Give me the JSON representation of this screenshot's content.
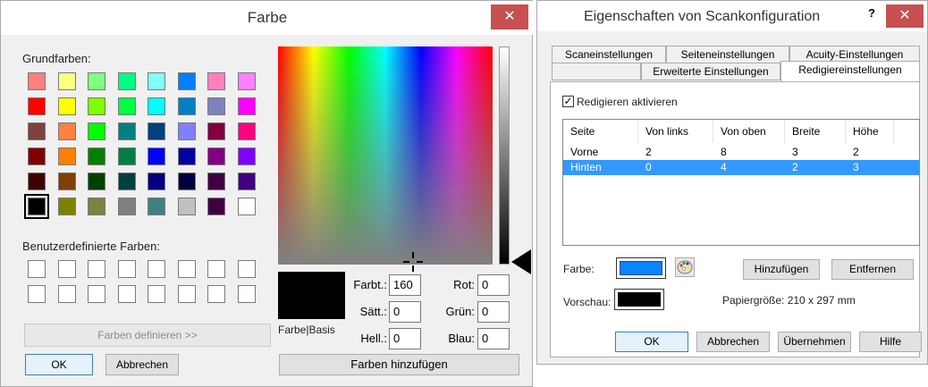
{
  "farbe": {
    "title": "Farbe",
    "close": "✕",
    "basic_label": "Grundfarben:",
    "basic_colors": [
      [
        "#ff8080",
        "#ffff80",
        "#80ff80",
        "#00ff80",
        "#80ffff",
        "#0080ff",
        "#ff80c0",
        "#ff80ff"
      ],
      [
        "#ff0000",
        "#ffff00",
        "#80ff00",
        "#00ff40",
        "#00ffff",
        "#0080c0",
        "#8080c0",
        "#ff00ff"
      ],
      [
        "#804040",
        "#ff8040",
        "#00ff00",
        "#008080",
        "#004080",
        "#8080ff",
        "#800040",
        "#ff0080"
      ],
      [
        "#800000",
        "#ff8000",
        "#008000",
        "#008040",
        "#0000ff",
        "#0000a0",
        "#800080",
        "#8000ff"
      ],
      [
        "#400000",
        "#804000",
        "#004000",
        "#004040",
        "#000080",
        "#000040",
        "#400040",
        "#400080"
      ],
      [
        "#000000",
        "#808000",
        "#808040",
        "#808080",
        "#408080",
        "#c0c0c0",
        "#400040",
        "#ffffff"
      ]
    ],
    "custom_label": "Benutzerdefinierte Farben:",
    "define_button": "Farben definieren >>",
    "ok": "OK",
    "cancel": "Abbrechen",
    "preview_label": "Farbe|Basis",
    "hue_label": "Farbt.:",
    "hue_value": "160",
    "sat_label": "Sätt.:",
    "sat_value": "0",
    "lum_label": "Hell.:",
    "lum_value": "0",
    "red_label": "Rot:",
    "red_value": "0",
    "green_label": "Grün:",
    "green_value": "0",
    "blue_label": "Blau:",
    "blue_value": "0",
    "add_button": "Farben hinzufügen",
    "selected_color": "#000000"
  },
  "scan": {
    "title": "Eigenschaften von Scankonfiguration",
    "help": "?",
    "close": "✕",
    "tabs_row1": [
      "Scaneinstellungen",
      "Seiteneinstellungen",
      "Acuity-Einstellungen"
    ],
    "tabs_row2": [
      "Erweiterte Einstellungen",
      "Redigiereinstellungen"
    ],
    "enable_label": "Redigieren aktivieren",
    "enable_checked": true,
    "columns": [
      "Seite",
      "Von links",
      "Von oben",
      "Breite",
      "Höhe"
    ],
    "rows": [
      [
        "Vorne",
        "2",
        "8",
        "3",
        "2"
      ],
      [
        "Hinten",
        "0",
        "4",
        "2",
        "3"
      ]
    ],
    "selected_row": 1,
    "color_label": "Farbe:",
    "color_value": "#0a84ff",
    "add": "Hinzufügen",
    "remove": "Entfernen",
    "preview_label": "Vorschau:",
    "paper_size": "Papiergröße:  210 x 297 mm",
    "ok": "OK",
    "cancel": "Abbrechen",
    "apply": "Übernehmen",
    "help_button": "Hilfe"
  }
}
